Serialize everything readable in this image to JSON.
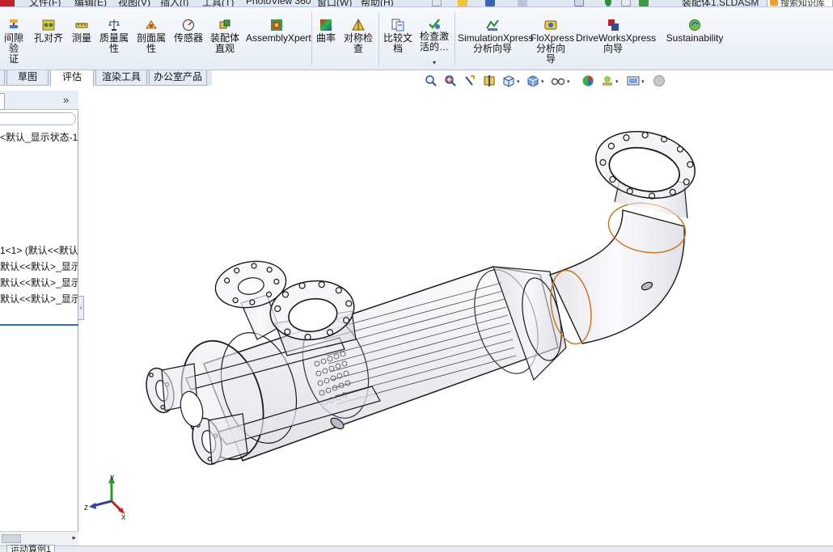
{
  "menubar": {
    "items": [
      "文件(F)",
      "编辑(E)",
      "视图(V)",
      "插入(I)",
      "工具(T)",
      "PhotoView 360",
      "窗口(W)",
      "帮助(H)"
    ],
    "document_title": "装配体1.SLDASM",
    "search_placeholder": "搜索知识库"
  },
  "command_manager": {
    "tools": [
      {
        "label": "间隙验\n证",
        "icon": "clearance-verification-icon"
      },
      {
        "label": "孔对齐",
        "icon": "hole-alignment-icon"
      },
      {
        "label": "测量",
        "icon": "measure-icon"
      },
      {
        "label": "质量属\n性",
        "icon": "mass-properties-icon"
      },
      {
        "label": "剖面属\n性",
        "icon": "section-properties-icon"
      },
      {
        "label": "传感器",
        "icon": "sensor-icon"
      },
      {
        "label": "装配体\n直观",
        "icon": "assembly-visualization-icon"
      },
      {
        "label": "AssemblyXpert",
        "icon": "assemblyxpert-icon"
      },
      {
        "label": "曲率",
        "icon": "curvature-icon"
      },
      {
        "label": "对称检\n查",
        "icon": "symmetry-check-icon"
      },
      {
        "label": "比较文\n档",
        "icon": "compare-documents-icon"
      },
      {
        "label": "检查激\n活的…",
        "icon": "check-active-icon"
      },
      {
        "label": "SimulationXpress\n分析向导",
        "icon": "simulationxpress-icon"
      },
      {
        "label": "FloXpress\n分析向\n导",
        "icon": "floxpress-icon"
      },
      {
        "label": "DriveWorksXpress\n向导",
        "icon": "driveworksxpress-icon"
      },
      {
        "label": "Sustainability",
        "icon": "sustainability-icon"
      }
    ]
  },
  "tabs": [
    {
      "label": "草图",
      "active": false
    },
    {
      "label": "评估",
      "active": true
    },
    {
      "label": "渲染工具",
      "active": false
    },
    {
      "label": "办公室产品",
      "active": false
    }
  ],
  "feature_tree": {
    "expand_symbol": "»",
    "items": [
      "<默认_显示状态-1",
      "1<1> (默认<<默认",
      "默认<<默认>_显示",
      "默认<<默认>_显示",
      "默认<<默认>_显示"
    ]
  },
  "triad": {
    "x": "X",
    "y": "Y",
    "z": "Z"
  },
  "bottom_tab": "运动算例1",
  "colors": {
    "accent": "#2c6fc4",
    "edge_highlight": "#c8771e",
    "model_edge": "#1a1a1a"
  }
}
